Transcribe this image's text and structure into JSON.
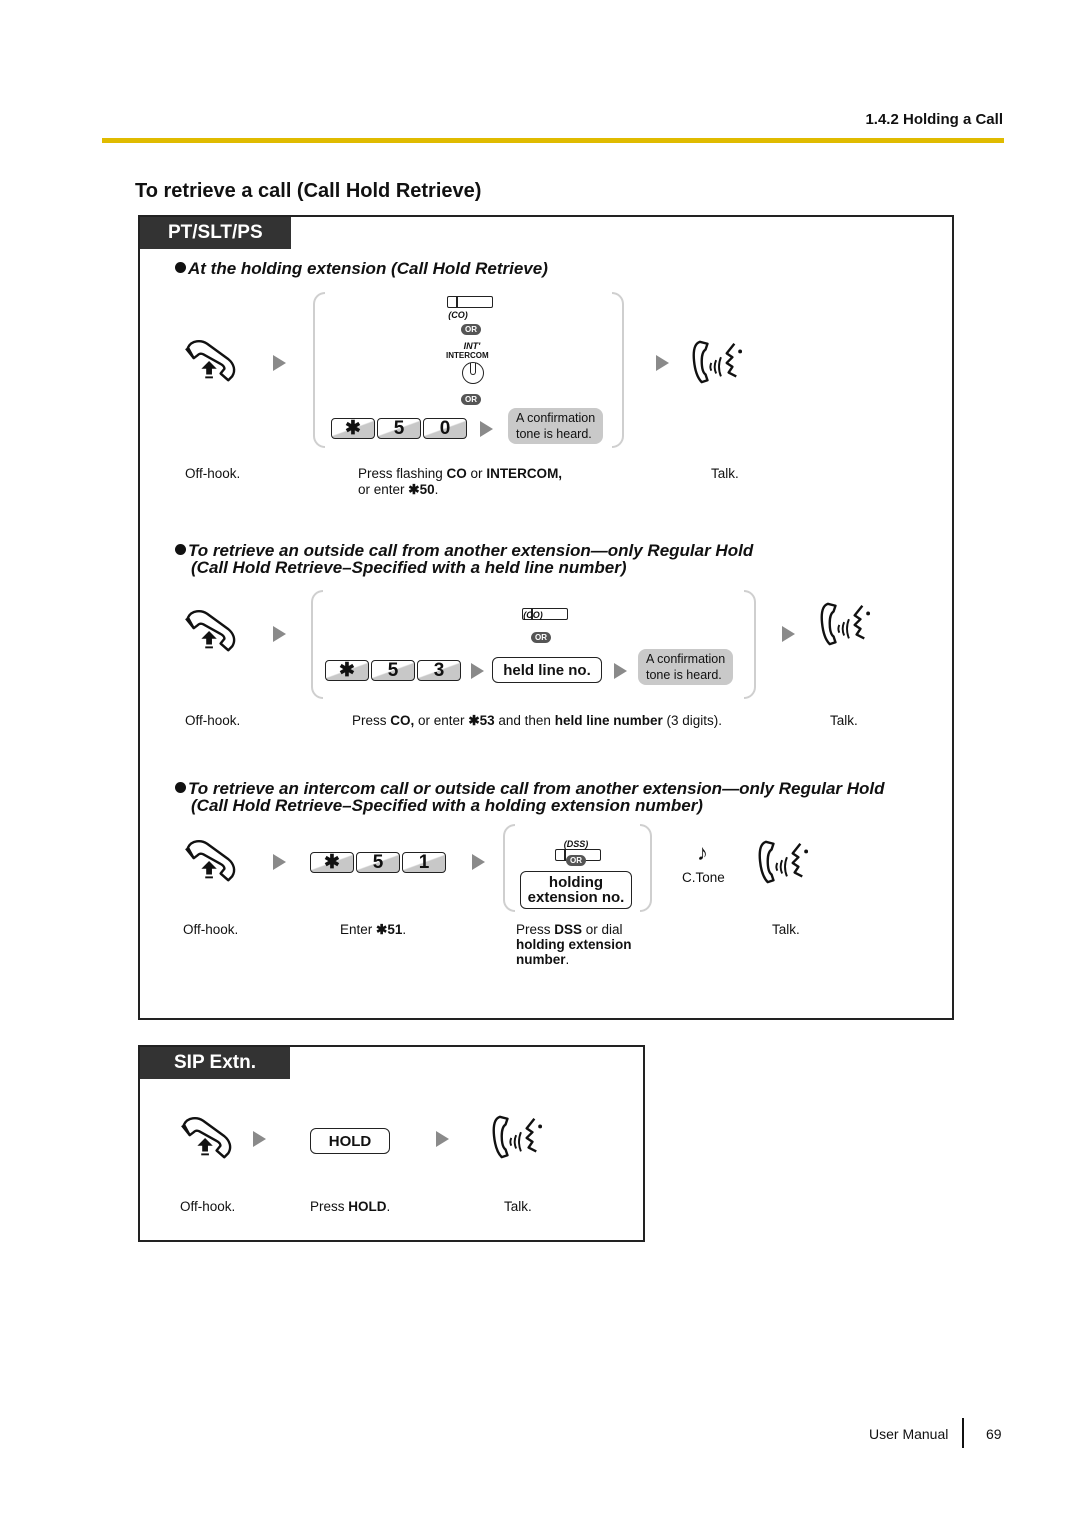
{
  "header": {
    "section": "1.4.2 Holding a Call",
    "accent_color": "#e0bb00"
  },
  "page_heading": "To retrieve a call (Call Hold Retrieve)",
  "panels": [
    {
      "tab": "PT/SLT/PS",
      "procedures": [
        {
          "title_lines": [
            "At the holding extension (Call Hold Retrieve)"
          ],
          "icons": {
            "off_hook": "off-hook-handset-icon",
            "talk": "talk-icon"
          },
          "co_label": "(CO)",
          "or_label": "OR",
          "intercom_small": "INT'",
          "intercom_label": "INTERCOM",
          "keys": [
            "✱",
            "5",
            "0"
          ],
          "tone_bubble": [
            "A confirmation",
            "tone is heard."
          ],
          "captions": {
            "off_hook": "Off-hook.",
            "press_prefix": "Press flashing ",
            "co": "CO",
            "or_text": " or ",
            "intercom": "INTERCOM,",
            "line2_prefix": "or enter ",
            "code": "✱50",
            "period": ".",
            "talk": "Talk."
          }
        },
        {
          "title_lines": [
            "To retrieve an outside call from another extension—only Regular Hold",
            "(Call Hold Retrieve–Specified with a held line number)"
          ],
          "co_label": "(CO)",
          "or_label": "OR",
          "keys": [
            "✱",
            "5",
            "3"
          ],
          "held_line_button": "held line no.",
          "tone_bubble": [
            "A confirmation",
            "tone is heard."
          ],
          "captions": {
            "off_hook": "Off-hook.",
            "press": "Press ",
            "co": "CO,",
            "or_enter": " or enter ",
            "code": "✱53",
            "and_then": " and then ",
            "held_line_number": "held line number",
            "digits": " (3 digits).",
            "talk": "Talk."
          }
        },
        {
          "title_lines": [
            "To retrieve an intercom call or outside call from another extension—only Regular Hold",
            "(Call Hold Retrieve–Specified with a holding extension number)"
          ],
          "keys": [
            "✱",
            "5",
            "1"
          ],
          "dss_label": "(DSS)",
          "or_label": "OR",
          "holding_ext_button": [
            "holding",
            "extension no."
          ],
          "ctone_label": "C.Tone",
          "captions": {
            "off_hook": "Off-hook.",
            "enter": "Enter ",
            "code": "✱51",
            "period": ".",
            "press": "Press ",
            "dss": "DSS",
            "or_dial": " or dial",
            "holding_extension": "holding extension",
            "number": "number",
            "talk": "Talk."
          }
        }
      ]
    },
    {
      "tab": "SIP Extn.",
      "hold_button": "HOLD",
      "captions": {
        "off_hook": "Off-hook.",
        "press": "Press ",
        "hold": "HOLD",
        "period": ".",
        "talk": "Talk."
      }
    }
  ],
  "footer": {
    "label": "User Manual",
    "page": "69"
  }
}
